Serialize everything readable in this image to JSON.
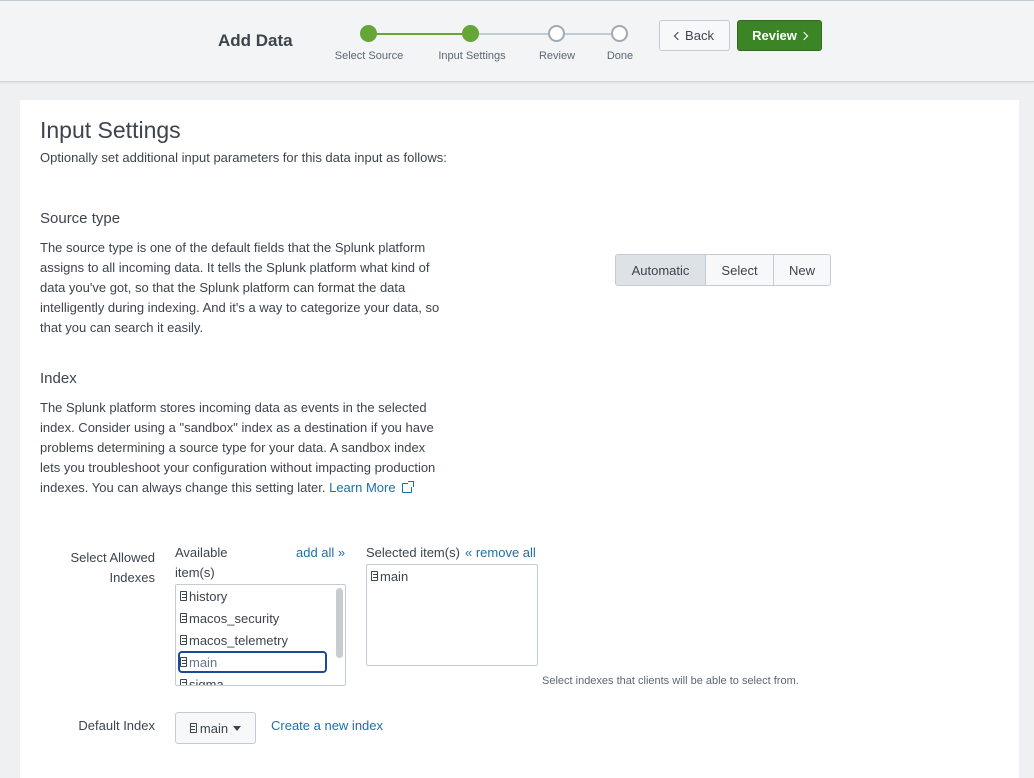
{
  "header": {
    "title": "Add Data",
    "steps": [
      {
        "label": "Select Source",
        "status": "done"
      },
      {
        "label": "Input Settings",
        "status": "done"
      },
      {
        "label": "Review",
        "status": "todo"
      },
      {
        "label": "Done",
        "status": "todo"
      }
    ],
    "back_label": "Back",
    "review_label": "Review"
  },
  "page": {
    "title": "Input Settings",
    "subtitle": "Optionally set additional input parameters for this data input as follows:"
  },
  "source_type": {
    "heading": "Source type",
    "description": "The source type is one of the default fields that the Splunk platform assigns to all incoming data. It tells the Splunk platform what kind of data you've got, so that the Splunk platform can format the data intelligently during indexing. And it's a way to categorize your data, so that you can search it easily.",
    "options": [
      "Automatic",
      "Select",
      "New"
    ],
    "selected": "Automatic"
  },
  "index": {
    "heading": "Index",
    "description": "The Splunk platform stores incoming data as events in the selected index. Consider using a \"sandbox\" index as a destination if you have problems determining a source type for your data. A sandbox index lets you troubleshoot your configuration without impacting production indexes. You can always change this setting later.",
    "learn_more": "Learn More",
    "allowed_label_line1": "Select Allowed",
    "allowed_label_line2": "Indexes",
    "available_header_line1": "Available",
    "available_header_line2": "item(s)",
    "add_all": "add all »",
    "selected_header": "Selected item(s)",
    "remove_all": "« remove all",
    "available_items": [
      "history",
      "macos_security",
      "macos_telemetry",
      "main",
      "sigma"
    ],
    "selected_items": [
      "main"
    ],
    "hint": "Select indexes that clients will be able to select from.",
    "default_label": "Default Index",
    "default_value": "main",
    "create_link": "Create a new index"
  },
  "colors": {
    "accent_green": "#65a637",
    "review_button": "#3c8527",
    "link": "#1e6fa8"
  }
}
